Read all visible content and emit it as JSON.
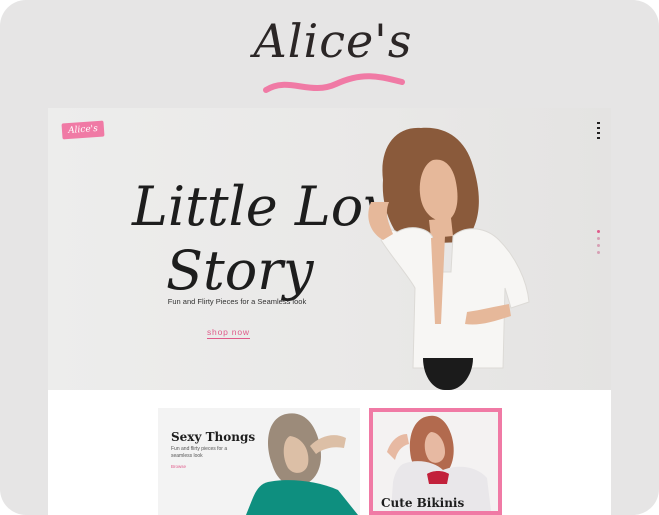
{
  "brand": {
    "name": "Alice's",
    "accent_color": "#f07aa5"
  },
  "site": {
    "logo_text": "Alice's",
    "menu_icon": "hamburger-menu-icon",
    "hero": {
      "title_line1": "Little Love",
      "title_line2": "Story",
      "subtitle": "Fun and Flirty Pieces for a Seamless look",
      "cta": "shop now"
    },
    "slider": {
      "count": 4,
      "active": 1
    },
    "promos": [
      {
        "title": "Sexy Thongs",
        "description": "Fun and flirty pieces for a seamless look",
        "link": "Browse"
      },
      {
        "title": "Cute Bikinis"
      }
    ]
  }
}
